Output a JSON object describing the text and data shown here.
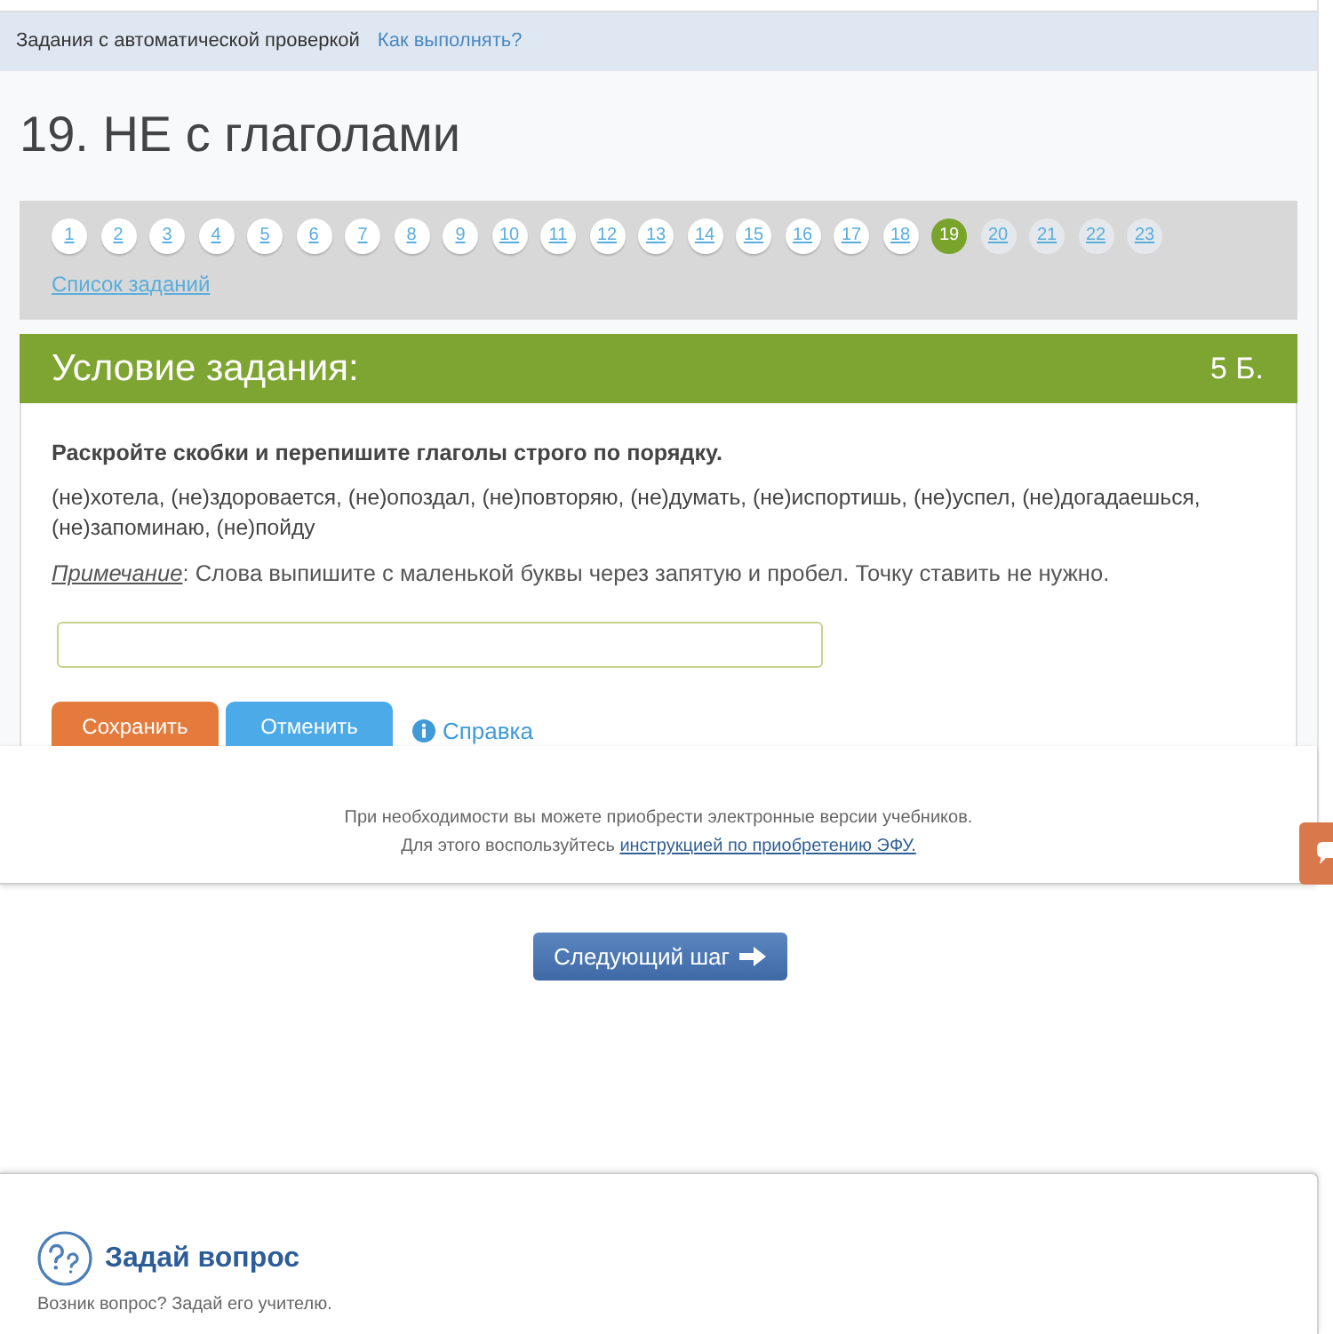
{
  "breadcrumb": {
    "section": "Задания с автоматической проверкой",
    "help_link": "Как выполнять?"
  },
  "title": "19. НЕ с глаголами",
  "task_nav": {
    "items": [
      {
        "label": "1",
        "selected": false,
        "done": true
      },
      {
        "label": "2",
        "selected": false,
        "done": true
      },
      {
        "label": "3",
        "selected": false,
        "done": true
      },
      {
        "label": "4",
        "selected": false,
        "done": true
      },
      {
        "label": "5",
        "selected": false,
        "done": true
      },
      {
        "label": "6",
        "selected": false,
        "done": true
      },
      {
        "label": "7",
        "selected": false,
        "done": true
      },
      {
        "label": "8",
        "selected": false,
        "done": true
      },
      {
        "label": "9",
        "selected": false,
        "done": true
      },
      {
        "label": "10",
        "selected": false,
        "done": true
      },
      {
        "label": "11",
        "selected": false,
        "done": true
      },
      {
        "label": "12",
        "selected": false,
        "done": true
      },
      {
        "label": "13",
        "selected": false,
        "done": true
      },
      {
        "label": "14",
        "selected": false,
        "done": true
      },
      {
        "label": "15",
        "selected": false,
        "done": true
      },
      {
        "label": "16",
        "selected": false,
        "done": true
      },
      {
        "label": "17",
        "selected": false,
        "done": true
      },
      {
        "label": "18",
        "selected": false,
        "done": true
      },
      {
        "label": "19",
        "selected": true,
        "done": false
      },
      {
        "label": "20",
        "selected": false,
        "done": false
      },
      {
        "label": "21",
        "selected": false,
        "done": false
      },
      {
        "label": "22",
        "selected": false,
        "done": false
      },
      {
        "label": "23",
        "selected": false,
        "done": false
      }
    ],
    "list_link": "Список заданий"
  },
  "task": {
    "header": "Условие задания:",
    "points": "5 Б.",
    "instruction": "Раскройте скобки и перепишите глаголы строго по порядку.",
    "words": "(не)хотела, (не)здоровается, (не)опоздал, (не)повторяю, (не)думать, (не)испортишь, (не)успел, (не)догадаешься, (не)запоминаю, (не)пойду",
    "note": "*Примечание*: Слова выпишите с маленькой буквы через запятую и пробел. Точку ставить не нужно.",
    "buttons": [
      {
        "label": "Сохранить",
        "kind": "save"
      },
      {
        "label": "Отменить",
        "kind": "cancel"
      }
    ],
    "help_link": "Справка"
  },
  "purchase_notice": {
    "line_1": "При необходимости вы можете приобрести электронные версии учебников.",
    "line_2": "Для этого воспользуйтесь",
    "line_2_link": "инструкцией по приобретению ЭФУ."
  },
  "next_button": "Следующий шаг",
  "ask_question": {
    "title": "Задай вопрос",
    "subtitle": "Возник вопрос? Задай его учителю."
  }
}
